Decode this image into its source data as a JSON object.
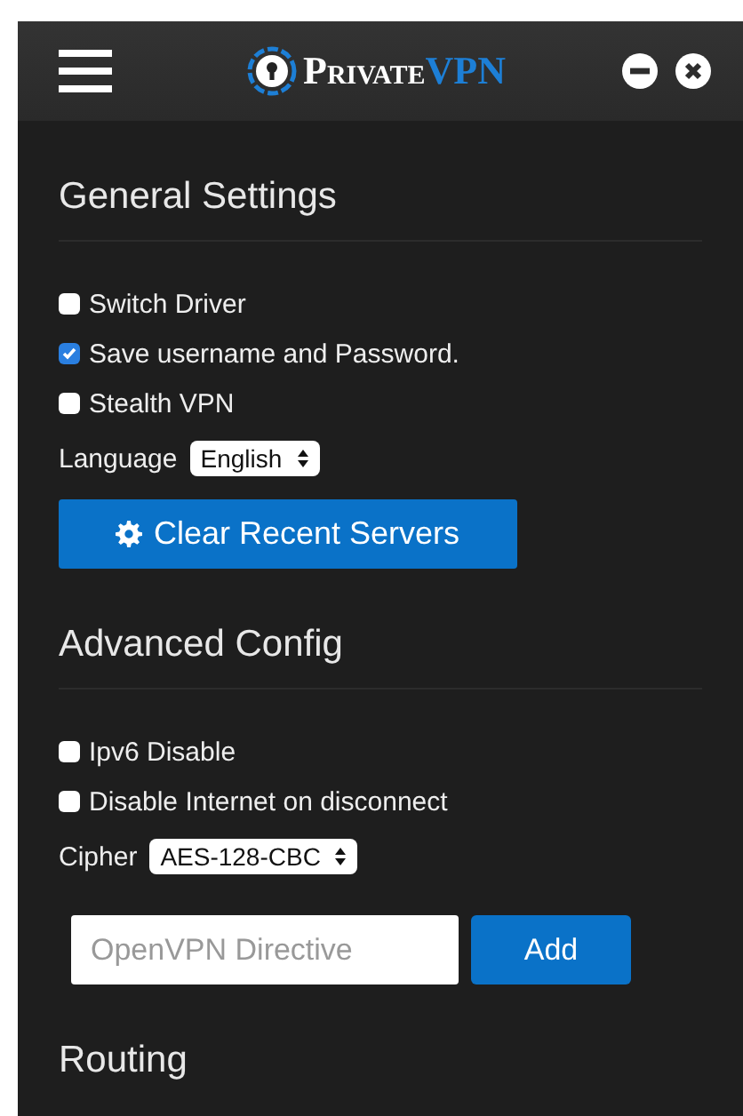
{
  "header": {
    "logo": {
      "brand": "Private",
      "accent": "VPN"
    }
  },
  "sections": [
    {
      "title": "General Settings",
      "items": [
        {
          "kind": "checkbox",
          "label": "Switch Driver",
          "checked": false
        },
        {
          "kind": "checkbox",
          "label": "Save username and Password.",
          "checked": true
        },
        {
          "kind": "checkbox",
          "label": "Stealth VPN",
          "checked": false
        },
        {
          "kind": "select",
          "label": "Language",
          "value": "English"
        },
        {
          "kind": "button",
          "label": "Clear Recent Servers"
        }
      ]
    },
    {
      "title": "Advanced Config",
      "items": [
        {
          "kind": "checkbox",
          "label": "Ipv6 Disable",
          "checked": false
        },
        {
          "kind": "checkbox",
          "label": "Disable Internet on disconnect",
          "checked": false
        },
        {
          "kind": "select",
          "label": "Cipher",
          "value": "AES-128-CBC"
        },
        {
          "kind": "directive",
          "placeholder": "OpenVPN Directive",
          "button": "Add"
        }
      ]
    },
    {
      "title": "Routing"
    }
  ]
}
